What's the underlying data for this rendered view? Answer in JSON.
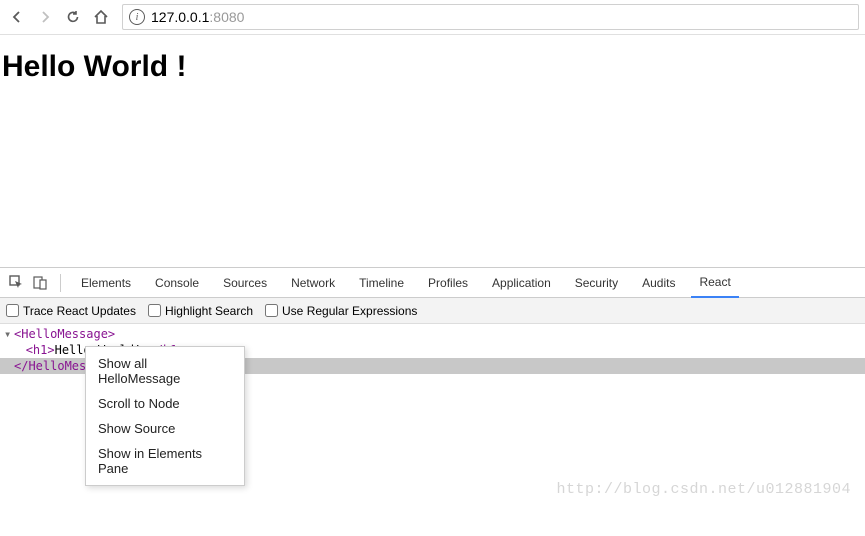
{
  "browser": {
    "url_host": "127.0.0.1",
    "url_port": ":8080"
  },
  "page": {
    "heading": "Hello World !"
  },
  "devtools": {
    "tabs": [
      "Elements",
      "Console",
      "Sources",
      "Network",
      "Timeline",
      "Profiles",
      "Application",
      "Security",
      "Audits",
      "React"
    ],
    "active_tab": "React",
    "options": {
      "trace": "Trace React Updates",
      "highlight": "Highlight Search",
      "regex": "Use Regular Expressions"
    },
    "tree": {
      "open_tag": "<HelloMessage>",
      "child_open": "<h1>",
      "child_text": "Hello World!",
      "child_close": " </h1>",
      "close_tag": "</HelloMessage>"
    },
    "context_menu": [
      "Show all HelloMessage",
      "Scroll to Node",
      "Show Source",
      "Show in Elements Pane"
    ]
  },
  "watermark": "http://blog.csdn.net/u012881904"
}
